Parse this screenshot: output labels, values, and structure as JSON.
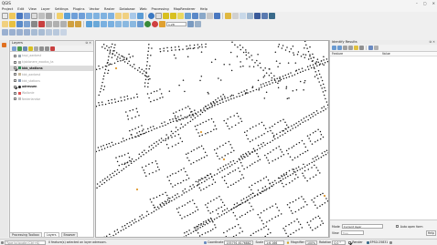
{
  "app": {
    "title": "QGIS",
    "window_controls": [
      "–",
      "▢",
      "✕"
    ]
  },
  "menu": [
    "Project",
    "Edit",
    "View",
    "Layer",
    "Settings",
    "Plugins",
    "Vector",
    "Raster",
    "Database",
    "Web",
    "Processing",
    "MapRenderer",
    "Help"
  ],
  "layers_panel": {
    "title": "Layers",
    "layers": [
      {
        "name": "kapi_aanbest",
        "checked": false,
        "color": "#9aa7b4",
        "selected": false
      },
      {
        "name": "kjablonere_exodus_ta",
        "checked": false,
        "color": "#b0b0b0",
        "selected": false
      },
      {
        "name": "kbk_stations",
        "checked": true,
        "color": "#2e8b57",
        "selected": true
      },
      {
        "name": "kbk_aanbest",
        "checked": false,
        "color": "#c7b89a",
        "selected": false
      },
      {
        "name": "kbk_stations",
        "checked": false,
        "color": "#8c9fb8",
        "selected": false
      },
      {
        "name": "adressen",
        "checked": true,
        "color": "#222222",
        "selected": false
      },
      {
        "name": "Wallonie",
        "checked": false,
        "color": "#e05252",
        "selected": false
      },
      {
        "name": "Nederlandse",
        "checked": false,
        "color": "#c0c0c0",
        "selected": false
      }
    ]
  },
  "bottom_tabs": [
    "Processing Toolbox",
    "Layers",
    "Browser"
  ],
  "active_tab": "Layers",
  "identify_panel": {
    "title": "Identify Results",
    "columns": [
      "Feature",
      "Value"
    ],
    "mode_label": "Mode",
    "mode_value": "Current layer",
    "auto_open_label": "Auto open form",
    "view_label": "View",
    "view_value": "Tree",
    "help_label": "Help"
  },
  "status": {
    "locator_placeholder": "Type to locate (Ctrl+K)",
    "message": "0 feature(s) selected on layer adressen.",
    "coordinate_label": "Coordinate",
    "coordinate_value": "155791,6176882",
    "scale_label": "Scale",
    "scale_value": "1:6.166",
    "magnifier_label": "Magnifier",
    "magnifier_value": "100%",
    "rotation_label": "Rotation",
    "rotation_value": "0,0 °",
    "render_label": "Render",
    "crs": "EPSG:25831"
  },
  "toolbar": {
    "scale_combo": "1:28"
  }
}
